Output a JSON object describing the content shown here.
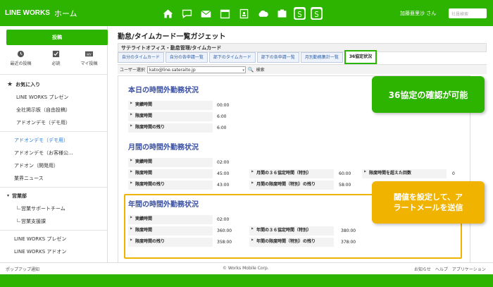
{
  "app": {
    "logo": "LINE WORKS",
    "title": "ホーム"
  },
  "topbar": {
    "icons": [
      "home-icon",
      "chat-icon",
      "mail-icon",
      "calendar-icon",
      "address-book-icon",
      "drive-icon",
      "task-icon",
      "app-s-icon",
      "app-s2-icon"
    ],
    "user": "加藤亜里沙 さん",
    "search_placeholder": "社員検索"
  },
  "sidebar": {
    "post_button": "投稿",
    "quick": [
      {
        "label": "最近の投稿",
        "icon": "clock-icon"
      },
      {
        "label": "必読",
        "icon": "check-icon"
      },
      {
        "label": "マイ投稿",
        "icon": "my-icon"
      }
    ],
    "favorites_label": "お気に入り",
    "favorites": [
      "LINE WORKS プレゼン",
      "全社掲示板（自由投稿）",
      "アドオンデモ（デモ用）"
    ],
    "groups": [
      "アドオンデモ（デモ用）",
      "アドオンデモ（お客様公...",
      "アドオン（開発用）",
      "業界ニュース"
    ],
    "dept_label": "営業部",
    "dept_items": [
      "営業サポートチーム",
      "営業支援課"
    ],
    "bottom": [
      "LINE WORKS プレゼン",
      "LINE WORKS アドオン"
    ]
  },
  "footer": {
    "left": "ポップアップ通知",
    "center": "© Works Mobile Corp.",
    "right": [
      "お知らせ",
      "ヘルプ",
      "アプリケーション"
    ]
  },
  "main": {
    "gadget_title": "勤怠/タイムカード一覧ガジェット",
    "breadcrumb": "サテライトオフィス・勤怠管理/タイムカード",
    "tabs": [
      "自分のタイムカード",
      "自分の各申請一覧",
      "部下のタイムカード",
      "部下の各申請一覧",
      "月別勤務集計一覧",
      "36協定状況"
    ],
    "user_select_label": "ユーザー選択",
    "user_select_value": "kato@line.sateraito.jp",
    "search_label": "検索",
    "today": {
      "title": "本日の時間外勤務状況",
      "rows": [
        {
          "label": "実績時間",
          "value": "00:00"
        },
        {
          "label": "限度時間",
          "value": "6:00"
        },
        {
          "label": "限度時間の残り",
          "value": "6:00"
        }
      ]
    },
    "month": {
      "title": "月間の時間外勤務状況",
      "actual_label": "実績時間",
      "actual": "02:00",
      "limit_label": "限度時間",
      "limit": "45:00",
      "special_label": "月間の３６協定時間（特別）",
      "special": "60:00",
      "exceed_label": "限度時間を超えた回数",
      "exceed": "0",
      "limit_rest_label": "限度時間の残り",
      "limit_rest": "43:00",
      "special_rest_label": "月間の限度時間（特別）の残り",
      "special_rest": "58:00"
    },
    "year": {
      "title": "年間の時間外勤務状況",
      "actual_label": "実績時間",
      "actual": "02:00",
      "limit_label": "限度時間",
      "limit": "360:00",
      "special_label": "年間の３６協定時間（特別）",
      "special": "380:00",
      "limit_rest_label": "限度時間の残り",
      "limit_rest": "358:00",
      "special_rest_label": "年間の限度時間（特別）の残り",
      "special_rest": "378:00"
    }
  },
  "callouts": {
    "green": "36協定の確認が可能",
    "orange_line1": "閾値を設定して、ア",
    "orange_line2": "ラートメールを送信"
  },
  "colors": {
    "brand": "#2db400",
    "highlight": "#f0b400",
    "section_title": "#3a4fa0"
  }
}
